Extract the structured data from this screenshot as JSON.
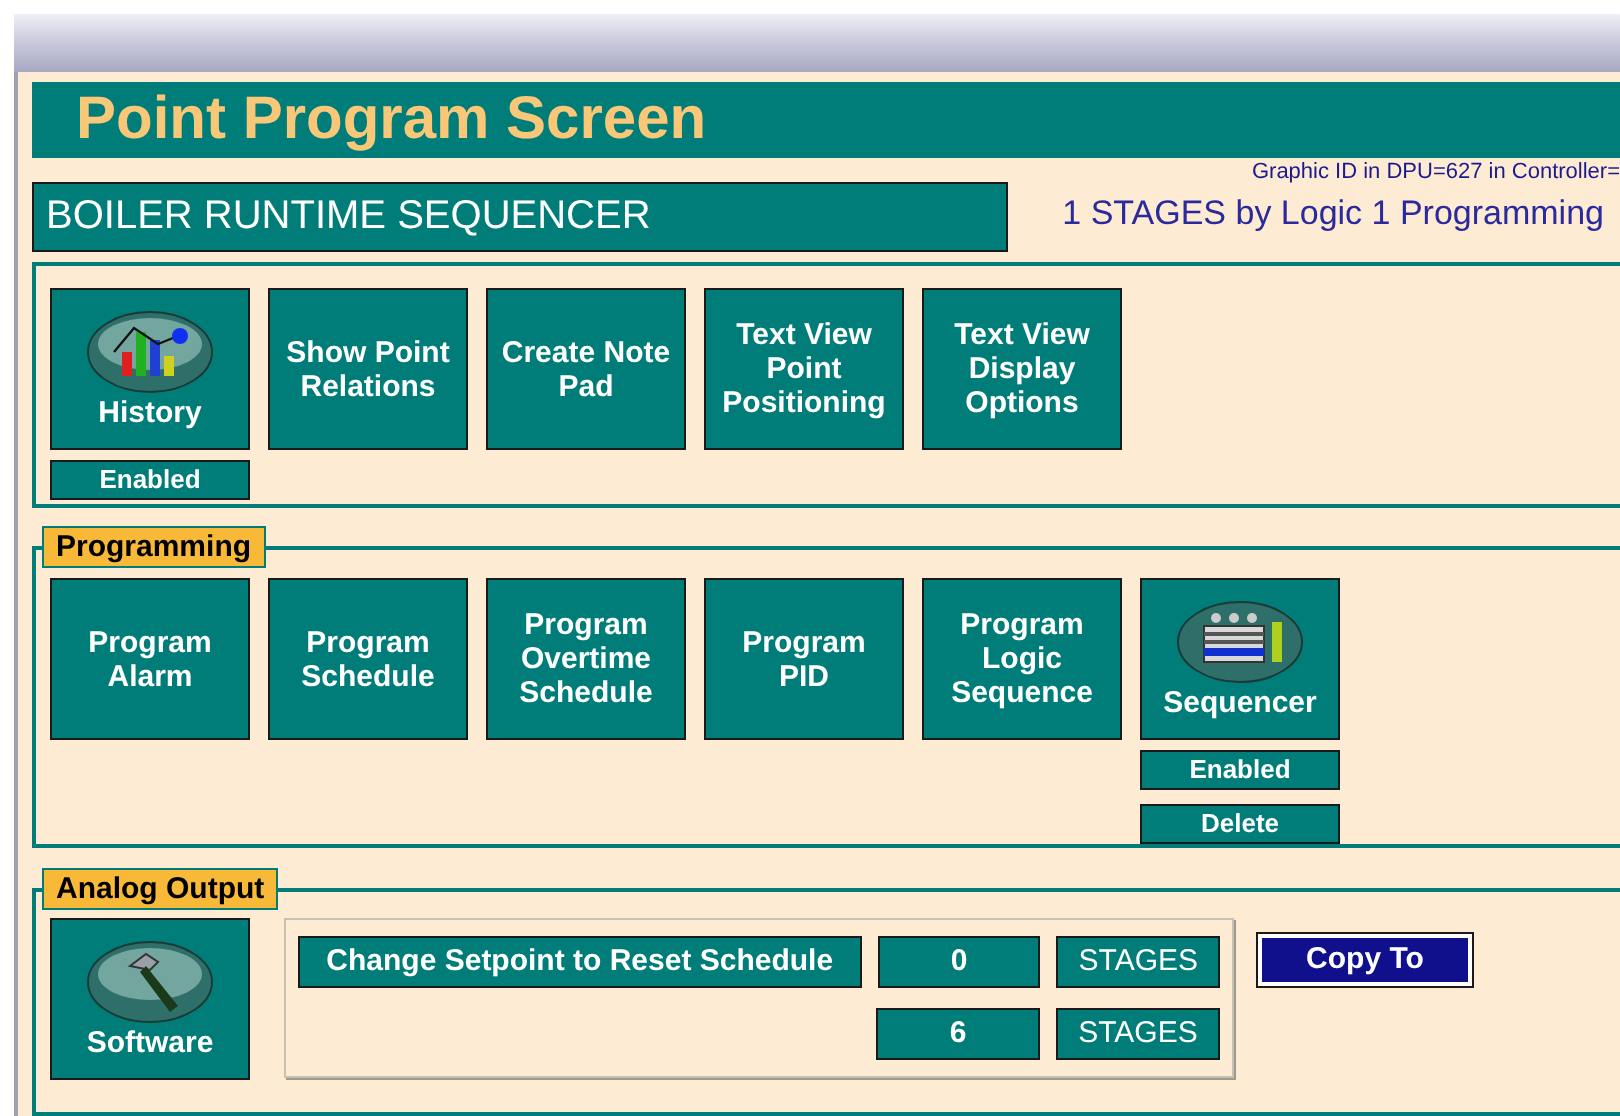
{
  "title": "Point Program Screen",
  "point_name": "BOILER RUNTIME SEQUENCER",
  "graphic_id": "Graphic ID in DPU=627 in Controller=",
  "summary": "1 STAGES by Logic 1 Programming",
  "tools": [
    {
      "kind": "chart",
      "label": "History",
      "status": "Enabled"
    },
    {
      "kind": "text",
      "label": "Show Point Relations"
    },
    {
      "kind": "text",
      "label": "Create Note Pad"
    },
    {
      "kind": "text",
      "label": "Text View Point Positioning"
    },
    {
      "kind": "text",
      "label": "Text View Display Options"
    }
  ],
  "programming": {
    "legend": "Programming",
    "buttons": [
      {
        "kind": "text",
        "label": "Program Alarm"
      },
      {
        "kind": "text",
        "label": "Program Schedule"
      },
      {
        "kind": "text",
        "label": "Program Overtime Schedule"
      },
      {
        "kind": "text",
        "label": "Program PID"
      },
      {
        "kind": "text",
        "label": "Program Logic Sequence"
      },
      {
        "kind": "sequencer",
        "label": "Sequencer",
        "status": "Enabled",
        "action": "Delete"
      }
    ]
  },
  "analog_output": {
    "legend": "Analog Output",
    "button": {
      "kind": "hammer",
      "label": "Software"
    },
    "reset_button": "Change Setpoint to Reset Schedule",
    "rows": [
      {
        "value": "0",
        "unit": "STAGES"
      },
      {
        "value": "6",
        "unit": "STAGES"
      }
    ],
    "copy_button": "Copy To"
  }
}
